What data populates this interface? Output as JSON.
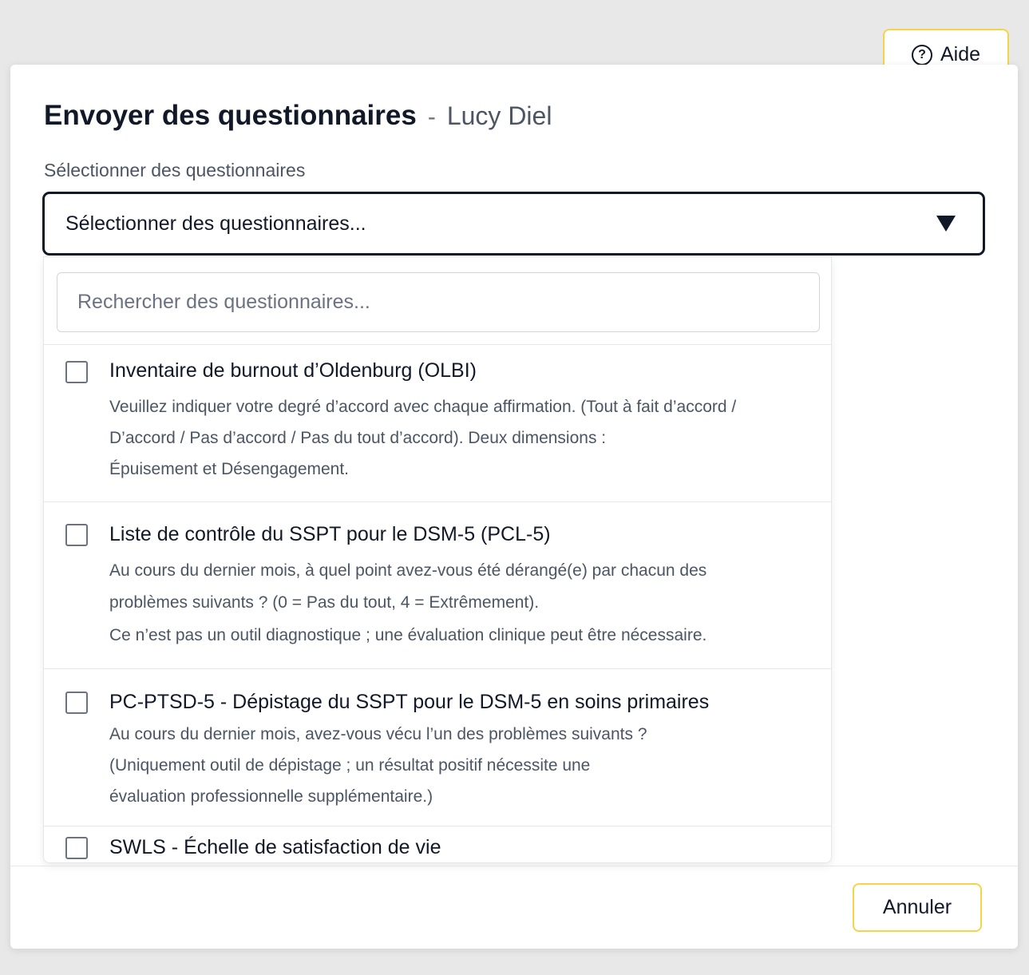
{
  "header": {
    "help_label": "Aide",
    "help_icon": "question-circle-icon"
  },
  "modal": {
    "title": "Envoyer des questionnaires",
    "separator": "-",
    "patient_name": "Lucy Diel",
    "field_label": "Sélectionner des questionnaires",
    "select_placeholder": "Sélectionner des questionnaires...",
    "search_placeholder": "Rechercher des questionnaires...",
    "options": [
      {
        "title": "Inventaire de burnout d’Oldenburg (OLBI)",
        "checked": false,
        "description": [
          "Veuillez indiquer votre degré d’accord avec chaque affirmation. (Tout à fait d’accord /",
          "D’accord / Pas d’accord / Pas du tout d’accord). Deux dimensions :",
          "Épuisement et Désengagement."
        ]
      },
      {
        "title": "Liste de contrôle du SSPT pour le DSM-5 (PCL-5)",
        "checked": false,
        "description": [
          "Au cours du dernier mois, à quel point avez-vous été dérangé(e) par chacun des",
          "problèmes suivants ? (0 = Pas du tout, 4 = Extrêmement).",
          "Ce n’est pas un outil diagnostique ; une évaluation clinique peut être nécessaire."
        ]
      },
      {
        "title": "PC-PTSD-5 - Dépistage du SSPT pour le DSM-5 en soins primaires",
        "checked": false,
        "description": [
          "Au cours du dernier mois, avez-vous vécu l’un des problèmes suivants ?",
          "(Uniquement outil de dépistage ; un résultat positif nécessite une",
          "évaluation professionnelle supplémentaire.)"
        ]
      },
      {
        "title": "SWLS - Échelle de satisfaction de vie",
        "checked": false,
        "description": []
      }
    ],
    "cancel_label": "Annuler"
  },
  "colors": {
    "accent_border": "#f5d547",
    "text_primary": "#111827",
    "text_secondary": "#4b5563",
    "background": "#e8e8e9"
  }
}
